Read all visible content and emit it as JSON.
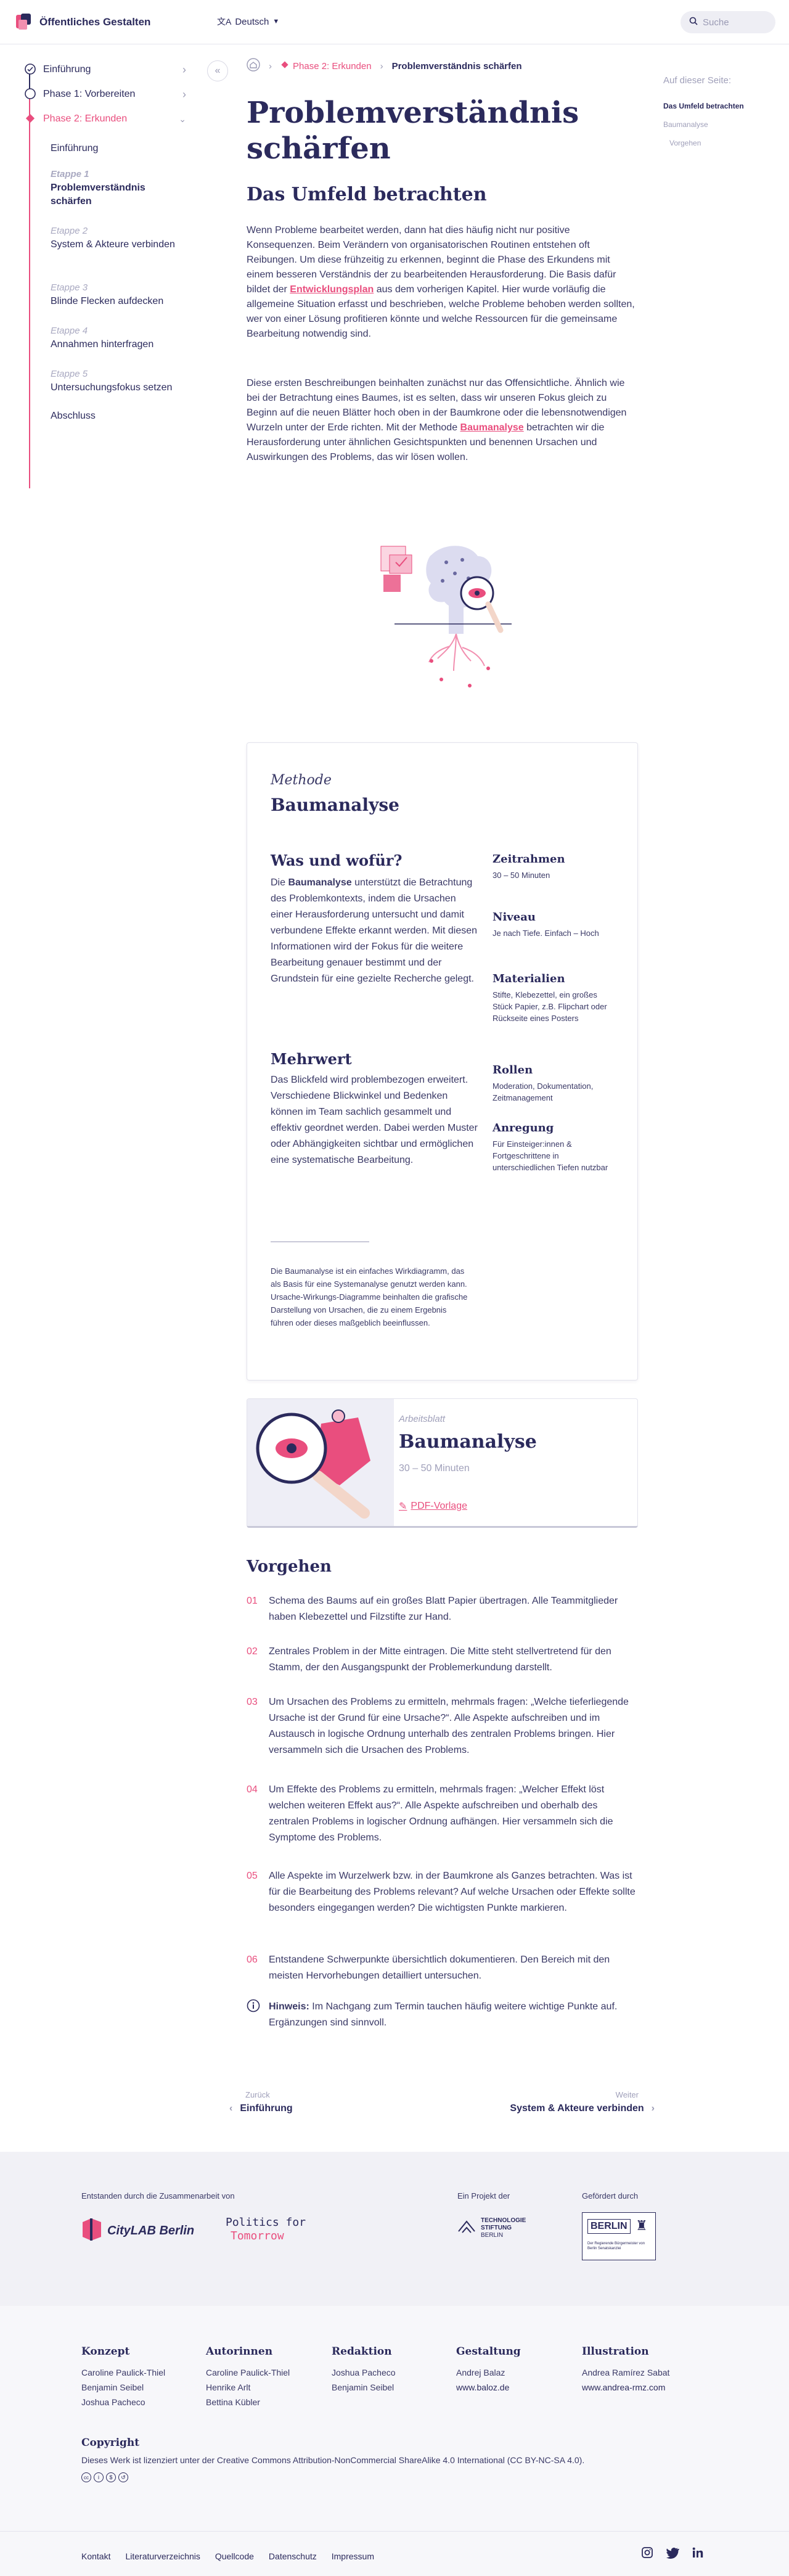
{
  "header": {
    "site_title": "Öffentliches Gestalten",
    "language": "Deutsch",
    "search_placeholder": "Suche"
  },
  "sidebar": {
    "phases": [
      {
        "label": "Einführung"
      },
      {
        "label": "Phase 1: Vorbereiten"
      },
      {
        "label": "Phase 2: Erkunden"
      }
    ],
    "items": [
      {
        "step": "",
        "label": "Einführung"
      },
      {
        "step": "Etappe 1",
        "label": "Problemverständnis schärfen"
      },
      {
        "step": "Etappe 2",
        "label": "System & Akteure verbinden"
      },
      {
        "step": "Etappe 3",
        "label": "Blinde Flecken aufdecken"
      },
      {
        "step": "Etappe 4",
        "label": "Annahmen hinterfragen"
      },
      {
        "step": "Etappe 5",
        "label": "Untersuchungsfokus setzen"
      },
      {
        "step": "",
        "label": "Abschluss"
      }
    ]
  },
  "toc": {
    "title": "Auf dieser Seite:",
    "items": [
      "Das Umfeld betrachten",
      "Baumanalyse",
      "Vorgehen"
    ]
  },
  "breadcrumb": {
    "phase": "Phase 2: Erkunden",
    "current": "Problemverständnis schärfen"
  },
  "page": {
    "title": "Problemverständnis schärfen",
    "section_title": "Das Umfeld betrachten",
    "para1_a": "Wenn Probleme bearbeitet werden, dann hat dies häufig nicht nur positive Konsequenzen. Beim Verändern von organisatorischen Routinen entstehen oft Reibungen. Um diese frühzeitig zu erkennen, beginnt die Phase des Erkundens mit einem besseren Verständnis der zu bearbeitenden Herausforderung. Die Basis dafür bildet der ",
    "para1_link": "Entwicklungsplan",
    "para1_b": " aus dem vorherigen Kapitel. Hier wurde vorläufig die allgemeine Situation erfasst und beschrieben, welche Probleme behoben werden sollten, wer von einer Lösung profitieren könnte und welche Ressourcen für die gemeinsame Bearbeitung notwendig sind.",
    "para2_a": "Diese ersten Beschreibungen beinhalten zunächst nur das Offensichtliche. Ähnlich wie bei der Betrachtung eines Baumes, ist es selten, dass wir unseren Fokus gleich zu Beginn auf die neuen Blätter hoch oben in der Baumkrone oder die lebensnotwendigen Wurzeln unter der Erde richten. Mit der Methode ",
    "para2_link": "Baumanalyse",
    "para2_b": " betrachten wir die Herausforderung unter ähnlichen Gesichtspunkten und benennen Ursachen und Auswirkungen des Problems, das wir lösen wollen."
  },
  "method": {
    "kind": "Methode",
    "title": "Baumanalyse",
    "what_heading": "Was und wofür?",
    "what_a": "Die ",
    "what_bold": "Baumanalyse",
    "what_b": " unterstützt die Betrachtung des Problemkontexts, indem die Ursachen einer Herausforderung untersucht und damit verbundene Effekte erkannt werden. Mit diesen Informationen wird der Fokus für die weitere Bearbeitung genauer bestimmt und der Grundstein für eine gezielte Recherche gelegt.",
    "value_heading": "Mehrwert",
    "value_text": "Das Blickfeld wird problembezogen erweitert. Verschiedene Blickwinkel und Bedenken können im Team sachlich gesammelt und effektiv geordnet werden. Dabei werden Muster oder Abhängigkeiten sichtbar und ermöglichen eine systematische Bearbeitung.",
    "meta": [
      {
        "label": "Zeitrahmen",
        "value": "30 – 50 Minuten"
      },
      {
        "label": "Niveau",
        "value": "Je nach Tiefe. Einfach – Hoch"
      },
      {
        "label": "Materialien",
        "value": "Stifte, Klebezettel, ein großes Stück Papier, z.B. Flipchart oder Rückseite eines Posters"
      },
      {
        "label": "Rollen",
        "value": "Moderation, Dokumentation, Zeitmanagement"
      },
      {
        "label": "Anregung",
        "value": "Für Einsteiger:innen & Fortgeschrittene in unterschiedlichen Tiefen nutzbar"
      }
    ],
    "note": "Die Baumanalyse ist ein einfaches Wirkdiagramm, das als Basis für eine Systemanalyse genutzt werden kann. Ursache-Wirkungs-Diagramme beinhalten die grafische Darstellung von Ursachen, die zu einem Ergebnis führen oder dieses maßgeblich beeinflussen."
  },
  "worksheet": {
    "kind": "Arbeitsblatt",
    "title": "Baumanalyse",
    "time": "30 – 50 Minuten",
    "pdf_label": "PDF-Vorlage"
  },
  "procedure": {
    "title": "Vorgehen",
    "steps": [
      {
        "num": "01",
        "text": "Schema des Baums auf ein großes Blatt Papier übertragen. Alle Teammitglieder haben Klebezettel und Filzstifte zur Hand."
      },
      {
        "num": "02",
        "text": "Zentrales Problem in der Mitte eintragen. Die Mitte steht stellvertretend für den Stamm, der den Ausgangspunkt der Problemerkundung darstellt."
      },
      {
        "num": "03",
        "text": "Um Ursachen des Problems zu ermitteln, mehrmals fragen: „Welche tieferliegende Ursache ist der Grund für eine Ursache?“. Alle Aspekte aufschreiben und im Austausch in logische Ordnung unterhalb des zentralen Problems bringen. Hier versammeln sich die Ursachen des Problems."
      },
      {
        "num": "04",
        "text": "Um Effekte des Problems zu ermitteln, mehrmals fragen: „Welcher Effekt löst welchen weiteren Effekt aus?“. Alle Aspekte aufschreiben und oberhalb des zentralen Problems in logischer Ordnung aufhängen. Hier versammeln sich die Symptome des Problems."
      },
      {
        "num": "05",
        "text": "Alle Aspekte im Wurzelwerk bzw. in der Baumkrone als Ganzes betrachten. Was ist für die Bearbeitung des Problems relevant? Auf welche Ursachen oder Effekte sollte besonders eingegangen werden? Die wichtigsten Punkte markieren."
      },
      {
        "num": "06",
        "text": "Entstandene Schwerpunkte übersichtlich dokumentieren. Den Bereich mit den meisten Hervorhebungen detailliert untersuchen."
      }
    ],
    "hint_label": "Hinweis:",
    "hint_text": " Im Nachgang zum Termin tauchen häufig weitere wichtige Punkte auf. Ergänzungen sind sinnvoll."
  },
  "pager": {
    "prev_small": "Zurück",
    "prev_label": "Einführung",
    "next_small": "Weiter",
    "next_label": "System & Akteure verbinden"
  },
  "footer": {
    "collab": "Entstanden durch die Zusammenarbeit von",
    "citylab": "CityLAB Berlin",
    "pft_line1": "Politics for",
    "pft_line2": "Tomorrow",
    "project": "Ein Projekt der",
    "tsb_line1": "TECHNOLOGIE",
    "tsb_line2": "STIFTUNG",
    "tsb_line3": "BERLIN",
    "funded": "Gefördert durch",
    "berlin": "BERLIN",
    "berlin_sub": "Der Regierende Bürgermeister von Berlin Senatskanzlei",
    "columns": [
      {
        "title": "Konzept",
        "lines": [
          "Caroline Paulick-Thiel",
          "Benjamin Seibel",
          "Joshua Pacheco"
        ]
      },
      {
        "title": "Autorinnen",
        "lines": [
          "Caroline Paulick-Thiel",
          "Henrike Arlt",
          "Bettina Kübler"
        ]
      },
      {
        "title": "Redaktion",
        "lines": [
          "Joshua Pacheco",
          "Benjamin Seibel"
        ]
      },
      {
        "title": "Gestaltung",
        "lines": [
          "Andrej Balaz",
          "www.baloz.de"
        ]
      },
      {
        "title": "Illustration",
        "lines": [
          "Andrea Ramírez Sabat",
          "www.andrea-rmz.com"
        ]
      }
    ],
    "copyright_title": "Copyright",
    "copyright_text": "Dieses Werk ist lizenziert unter der Creative Commons Attribution-NonCommercial ShareAlike 4.0 International (CC BY-NC-SA 4.0).",
    "links": [
      "Kontakt",
      "Literaturverzeichnis",
      "Quellcode",
      "Datenschutz",
      "Impressum"
    ]
  },
  "colors": {
    "accent": "#e94e7e",
    "navy": "#2b2a5c",
    "muted": "#a0a0ba"
  }
}
